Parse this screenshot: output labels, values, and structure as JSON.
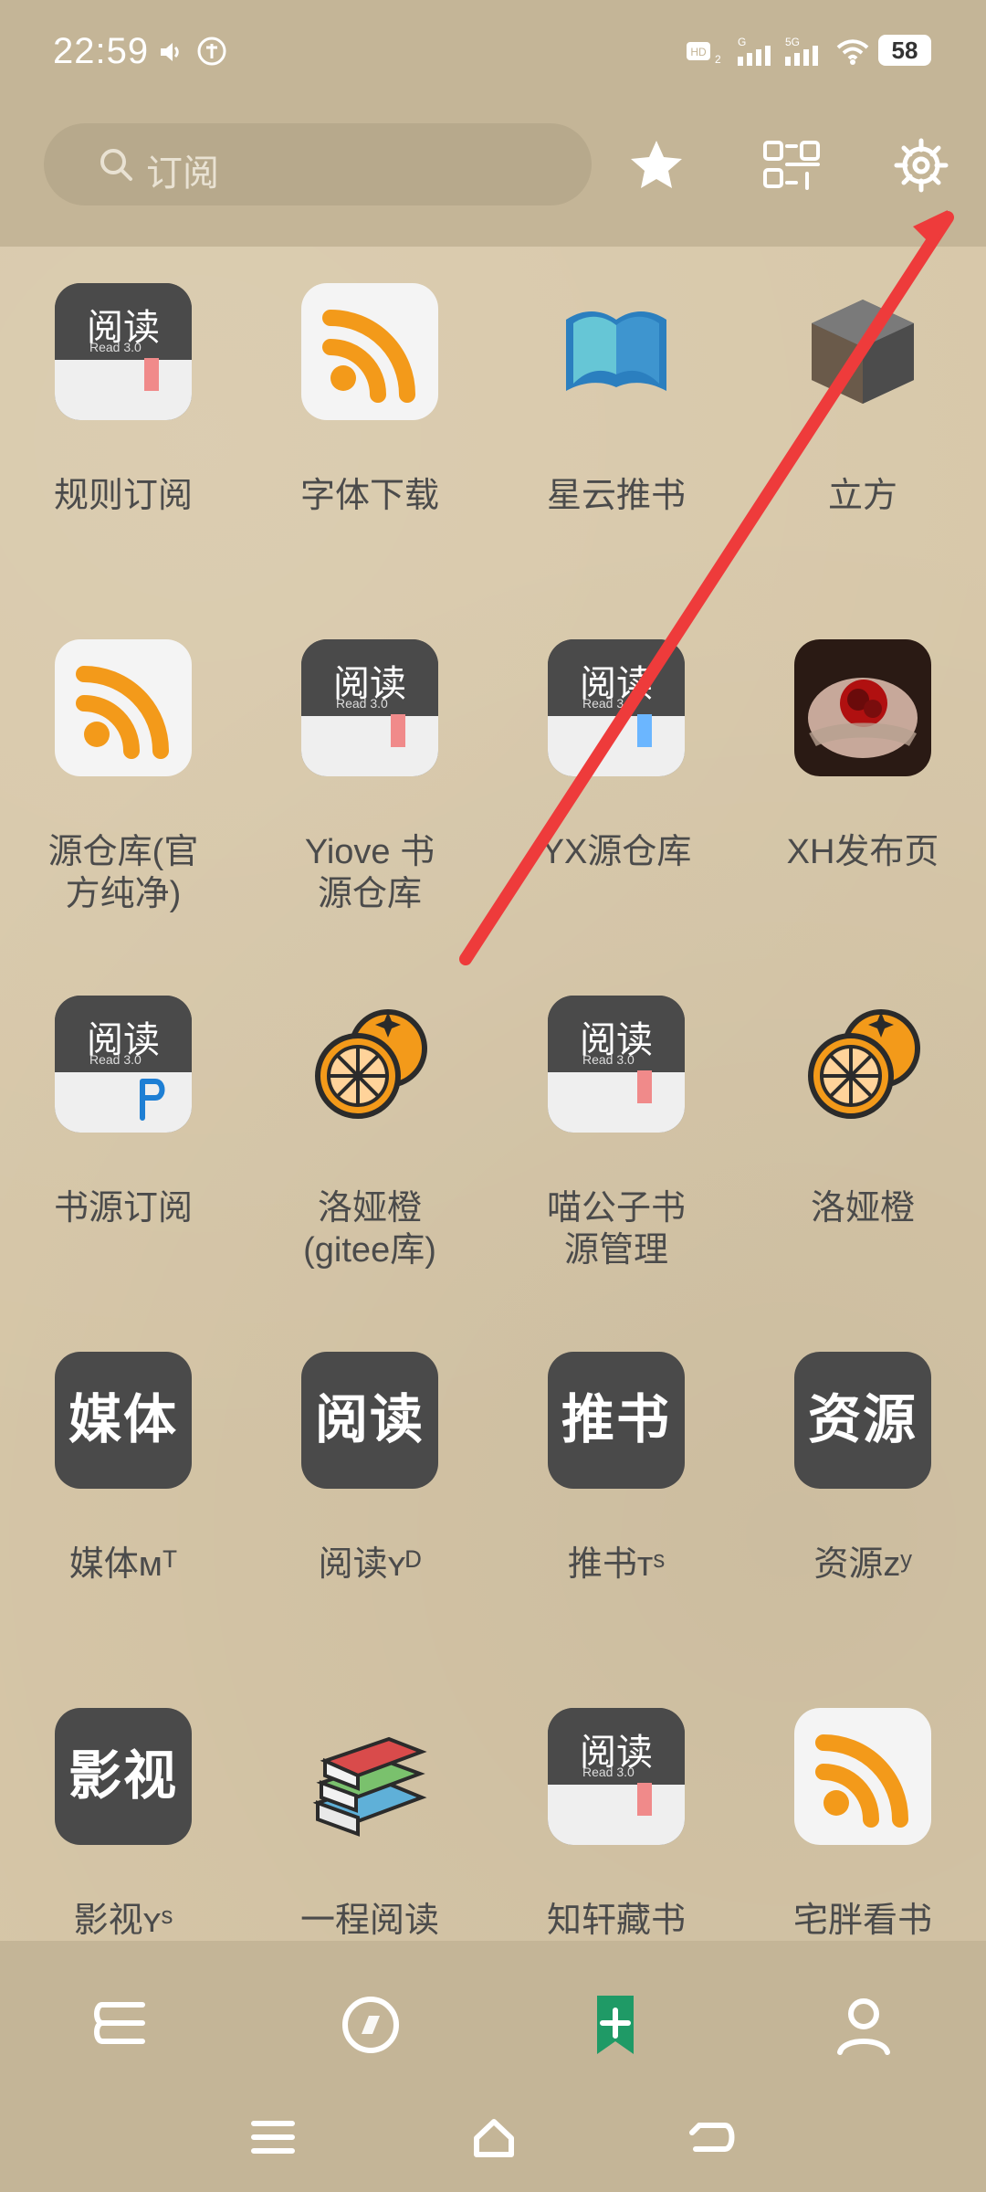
{
  "status_bar": {
    "time": "22:59",
    "battery": "58",
    "icons": [
      "volume-icon",
      "sync-icon",
      "hd2-icon",
      "signal-icon",
      "5g-icon",
      "wifi-icon",
      "battery-icon"
    ]
  },
  "header": {
    "search_placeholder": "订阅",
    "buttons": [
      "star-icon",
      "scan-icon",
      "settings-icon"
    ]
  },
  "grid": {
    "items": [
      {
        "label": "规则订阅",
        "icon": "read-app-icon"
      },
      {
        "label": "字体下载",
        "icon": "rss-icon"
      },
      {
        "label": "星云推书",
        "icon": "book-fan-icon"
      },
      {
        "label": "立方",
        "icon": "cube-icon"
      },
      {
        "label": "源仓库(官\n方纯净)",
        "icon": "rss-icon"
      },
      {
        "label": "Yiove 书\n源仓库",
        "icon": "read-app-icon"
      },
      {
        "label": "YX源仓库",
        "icon": "read-app-icon"
      },
      {
        "label": "XH发布页",
        "icon": "rose-photo-icon"
      },
      {
        "label": "书源订阅",
        "icon": "read-app-p-icon"
      },
      {
        "label": "洛娅橙\n(gitee库)",
        "icon": "orange-icon"
      },
      {
        "label": "喵公子书\n源管理",
        "icon": "read-app-icon"
      },
      {
        "label": "洛娅橙",
        "icon": "orange-icon"
      },
      {
        "label": "媒体ᴍᵀ",
        "icon": "tile-meiti"
      },
      {
        "label": "阅读ʏᴰ",
        "icon": "tile-yuedu"
      },
      {
        "label": "推书ᴛˢ",
        "icon": "tile-tuishu"
      },
      {
        "label": "资源ᴢʸ",
        "icon": "tile-ziyuan"
      },
      {
        "label": "影视ʏˢ",
        "icon": "tile-yingshi"
      },
      {
        "label": "一程阅读",
        "icon": "book-stack-icon"
      },
      {
        "label": "知轩藏书",
        "icon": "read-app-icon"
      },
      {
        "label": "宅胖看书",
        "icon": "rss-icon"
      }
    ],
    "tile_texts": {
      "meiti": "媒体",
      "yuedu": "阅读",
      "tuishu": "推书",
      "ziyuan": "资源",
      "yingshi": "影视"
    },
    "read_app": {
      "title": "阅读",
      "subtitle": "Read 3.0"
    }
  },
  "bottom_nav": {
    "items": [
      "bookshelf-icon",
      "discover-icon",
      "subscribe-icon",
      "profile-icon"
    ],
    "active": "subscribe-icon"
  },
  "colors": {
    "bar": "#c4b597",
    "paper": "#d7c7a8",
    "active_green": "#1f9a66",
    "rss_orange": "#f39a1a",
    "dark_tile": "#4a4a4a",
    "annotation_red": "#ee3b3b"
  }
}
